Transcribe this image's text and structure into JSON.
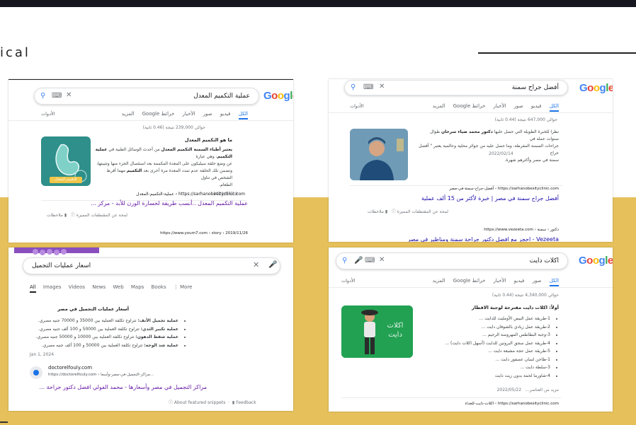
{
  "page": {
    "title": "ical"
  },
  "screenshot1": {
    "logo": "Google",
    "query": "عملية التكميم المعدل",
    "tabs": [
      "الكل",
      "فيديو",
      "صور",
      "الأخبار",
      "خرائط Google",
      "المزيد"
    ],
    "tools": "الأدوات",
    "results_count": "حوالي 239,000 نتيجة (0.46 ثانية)",
    "question": "ما هو التكميم المعدل",
    "snippet_line1_bold": "يعتبر أطباء السمنة التكميم المعدل",
    "snippet_line1_rest": "من أحدث الوسائل الطبية في",
    "snippet_line1_bold2": "عملية التكميم",
    "snippet_line1_rest2": "، وهي عبارة",
    "snippet_line2": "عن وضع حلقة سيليكون على المعدة المكممة بعد استئصال الجزء منها وتثبيتها،",
    "snippet_line3": "وتضمن تلك الحلقة عدم تمدد المعدة مرة أخرى بعد",
    "snippet_line3_bold": "التكميم",
    "snippet_line3_rest": "مهما أفرط الشخص في تناول",
    "snippet_line4": "الطعام.",
    "date": "2021/07/19",
    "url": "https://sarhanobesityclinic.com › عملية-التكميم-المعدل",
    "link": "عملية التكميم المعدل ..أنسب طريقة لخسارة الوزن للأبد - مركز ...",
    "about": "لمحة عن المقتطفات المميزة",
    "feedback": "ملاحظات",
    "url2": "https://www.youm7.com › story › 2019/11/26",
    "thumb_caption": "التكميم المعدل"
  },
  "screenshot2": {
    "logo": "Google",
    "query": "أفضل جراح سمنة",
    "tabs": [
      "الكل",
      "فيديو",
      "صور",
      "الأخبار",
      "خرائط Google",
      "المزيد"
    ],
    "tools": "الأدوات",
    "results_count": "حوالي 647,000 نتيجة (0.44 ثانية)",
    "snippet_line1": "نظرا للخبرة الطويلة التي حصل عليها",
    "snippet_line1_bold": "دكتور محمد ضياء سرحان",
    "snippet_line1_rest": "طوال سنوات عمله في",
    "snippet_line2": "جراحات السمنة المفرطة، وما حصل عليه من جوائز محلية وعالمية يعتبر \" أفضل جراح",
    "snippet_line3": "سمنة في مصر وأكثرهم شهرة.",
    "date": "2022/02/14",
    "url": "https://sarhanobesityclinic.com › أفضل-جراح-سمنة-في-مصر",
    "link": "أفضل جراح سمنة في مصر | خبرة لأكثر من 15 ألف عملية",
    "about": "لمحة عن المقتطفات المميزة",
    "feedback": "ملاحظات",
    "url2": "https://www.vezeeta.com › دكتور › سمنة",
    "link2": "Vezeeta - احجز مع افضل دكتور جراحة سمنة ومناظير في مصر"
  },
  "screenshot3": {
    "query": "اسعار عمليات التجميل",
    "tabs": [
      "All",
      "Images",
      "Videos",
      "News",
      "Web",
      "Maps",
      "Books",
      "More"
    ],
    "heading": "أسعار عمليات التجميل في مصر",
    "bullets": [
      {
        "bold": "عملية تجميل الأنف:",
        "rest": "تتراوح تكلفة العملية بين 35000 و 70000 جنيه مصري."
      },
      {
        "bold": "عملية تكبير الثدي:",
        "rest": "تتراوح تكلفة العملية بين 50000 و 100 ألف جنيه مصري."
      },
      {
        "bold": "عملية شفط الدهون:",
        "rest": "تتراوح تكلفة العملية بين 10000 و 50000 جنيه مصري."
      },
      {
        "bold": "عملية شد الوجه:",
        "rest": "تتراوح تكلفة العملية بين 50000 و 100 ألف جنيه مصري."
      }
    ],
    "date": "Jan 1, 2024",
    "site": "doctorelfouly.com",
    "url": "https://doctorelfouly.com › مراكز-التجميل-في-مصر-وأسعا...",
    "link": "مراكز التجميل في مصر وأسعارها - محمد الفولي افضل دكتور جراحة ...",
    "about": "About featured snippets",
    "feedback": "Feedback"
  },
  "screenshot4": {
    "logo": "Google",
    "query": "اكلات دايت",
    "tabs": [
      "الكل",
      "صور",
      "فيديو",
      "الأخبار",
      "خرائط Google",
      "المزيد"
    ],
    "tools": "الأدوات",
    "results_count": "حوالي 4,340,000 نتيجة (0.44 ثانية)",
    "heading": "أولاً: اكلات دايت مقترحة لوجبة الافطار",
    "items": [
      "1-طريقة عمل البيض الأومليت للدايت ...",
      "2-طريقة عمل زبادي بالشوفان دايت ...",
      "3-وجبة البطاطس المهروسة الرجيم ...",
      "4-طريقة عمل سجق البروتين للدايت (أسهل اكلات دايت) ...",
      "5-طريقة عمل عجة مشبعة دايت ...",
      "1-طاجن لسان عصفور دايت ...",
      "3-سلطة دايت ...",
      "4-شاورما لحمة بدون زيت دايت"
    ],
    "more": "مزيد من العناصر...",
    "date": "2022/05/22",
    "url": "https://sarhanobesityclinic.com › اكلات-دايت-للغداء",
    "thumb_text": "اكلات دايت"
  },
  "colors": {
    "yellow": "#e6c05a",
    "dark": "#16161e",
    "google_blue": "#4285f4",
    "link_blue": "#1a0dab"
  }
}
